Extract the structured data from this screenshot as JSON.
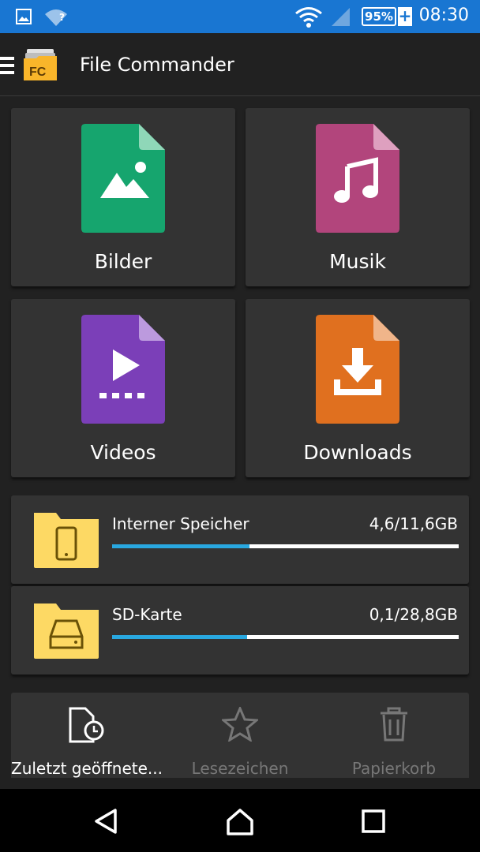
{
  "status_bar": {
    "time": "08:30",
    "battery": "95%",
    "battery_plus": "+",
    "wifi_badge": "?",
    "icons": [
      "image-icon",
      "wifi-unknown-icon",
      "wifi-icon",
      "signal-icon",
      "battery-icon"
    ]
  },
  "toolbar": {
    "title": "File Commander",
    "logo_text": "FC",
    "icons": [
      "menu-icon",
      "app-logo-icon"
    ]
  },
  "categories": [
    {
      "label": "Bilder",
      "icon": "image-file-icon",
      "color": "#16a56e"
    },
    {
      "label": "Musik",
      "icon": "music-file-icon",
      "color": "#b2457c"
    },
    {
      "label": "Videos",
      "icon": "video-file-icon",
      "color": "#7b3fb8"
    },
    {
      "label": "Downloads",
      "icon": "download-file-icon",
      "color": "#e0701f"
    }
  ],
  "storage": [
    {
      "name": "Interner Speicher",
      "size": "4,6/11,6GB",
      "used_fraction": 0.397,
      "icon": "phone-folder-icon"
    },
    {
      "name": "SD-Karte",
      "size": "0,1/28,8GB",
      "used_fraction": 0.39,
      "icon": "sd-card-folder-icon"
    }
  ],
  "quick_actions": [
    {
      "label": "Zuletzt geöffnete...",
      "icon": "recent-files-icon",
      "active": true
    },
    {
      "label": "Lesezeichen",
      "icon": "star-icon",
      "active": false
    },
    {
      "label": "Papierkorb",
      "icon": "trash-icon",
      "active": false
    }
  ],
  "nav_bar": {
    "icons": [
      "back-icon",
      "home-icon",
      "recents-icon"
    ]
  },
  "colors": {
    "status_bar": "#1976d2",
    "background": "#212121",
    "card": "#333333",
    "progress": "#29a8e0",
    "folder": "#fdd964",
    "inactive_text": "#777777"
  }
}
